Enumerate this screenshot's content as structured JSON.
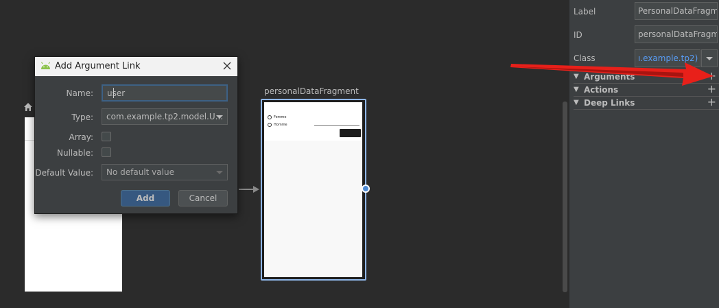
{
  "canvas": {
    "fragment": {
      "title": "personalDataFragment",
      "radio1": "Femme",
      "radio2": "Homme"
    }
  },
  "panel": {
    "label_label": "Label",
    "label_value": "PersonalDataFragment",
    "id_label": "ID",
    "id_value": "personalDataFragment",
    "class_label": "Class",
    "class_value": "ı.example.tp2)",
    "sections": [
      {
        "label": "Arguments",
        "plus": "+"
      },
      {
        "label": "Actions",
        "plus": "+"
      },
      {
        "label": "Deep Links",
        "plus": "+"
      }
    ]
  },
  "dialog": {
    "title": "Add Argument Link",
    "name_label": "Name:",
    "name_value": "user",
    "type_label": "Type:",
    "type_value": "com.example.tp2.model.U...",
    "array_label": "Array:",
    "nullable_label": "Nullable:",
    "default_label": "Default Value:",
    "default_value": "No default value",
    "add_label": "Add",
    "cancel_label": "Cancel"
  },
  "colors": {
    "accent": "#365880",
    "selection_border": "#8fb6e8",
    "annotation_arrow": "#e8201a",
    "link_text": "#589df6"
  },
  "icons": [
    "home-icon",
    "android-icon",
    "close-icon",
    "plus-icon",
    "chevron-down-icon",
    "triangle-down-icon"
  ]
}
